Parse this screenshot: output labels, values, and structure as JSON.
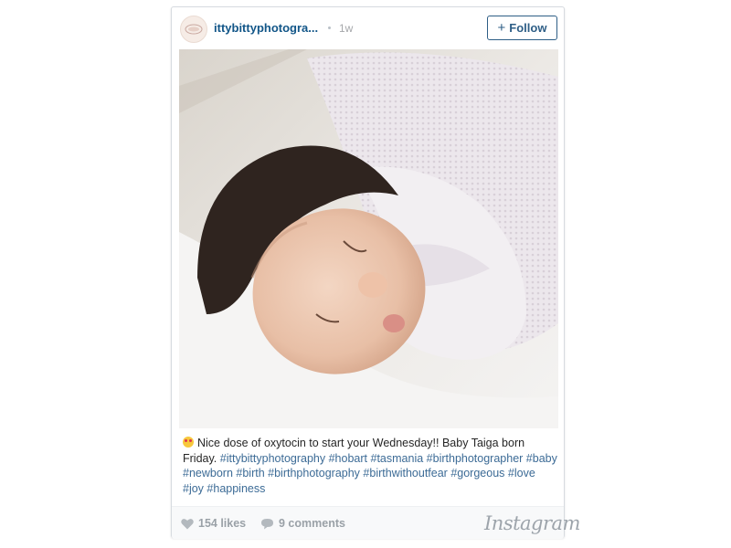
{
  "post": {
    "username": "ittybittyphotogra...",
    "time": "1w",
    "follow_label": "Follow",
    "follow_icon": "plus-icon"
  },
  "caption": {
    "text": "Nice dose of oxytocin to start your Wednesday!! Baby Taiga born Friday.",
    "emoji": "heart-eyes-emoji",
    "hashtags": [
      "#ittybittyphotography",
      "#hobart",
      "#tasmania",
      "#birthphotographer",
      "#baby",
      "#newborn",
      "#birth",
      "#birthphotography",
      "#birthwithoutfear",
      "#gorgeous",
      "#love",
      "#joy",
      "#happiness"
    ]
  },
  "footer": {
    "likes": "154 likes",
    "comments": "9 comments",
    "brand": "Instagram"
  },
  "colors": {
    "link": "#125688",
    "hashtag": "#3c6b96",
    "follow_border": "#2e5e86",
    "muted": "#9aa1a7"
  }
}
